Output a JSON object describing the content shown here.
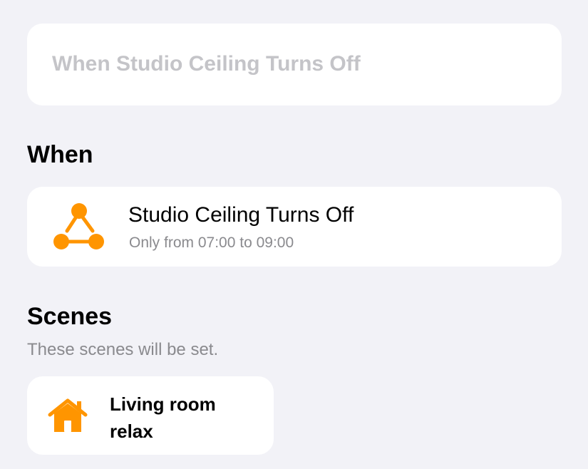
{
  "automation": {
    "name": "When Studio Ceiling Turns Off"
  },
  "when_section": {
    "title": "When",
    "trigger": {
      "icon": "automation-trigger-icon",
      "title": "Studio Ceiling Turns Off",
      "detail": "Only from 07:00 to 09:00"
    }
  },
  "scenes_section": {
    "title": "Scenes",
    "subtitle": "These scenes will be set.",
    "scenes": [
      {
        "icon": "home-icon",
        "name": "Living room relax"
      }
    ]
  },
  "colors": {
    "background": "#f2f2f7",
    "card": "#ffffff",
    "accent_orange": "#ff9500",
    "secondary_text": "#8a8a8e",
    "placeholder_text": "#c4c4c8"
  }
}
